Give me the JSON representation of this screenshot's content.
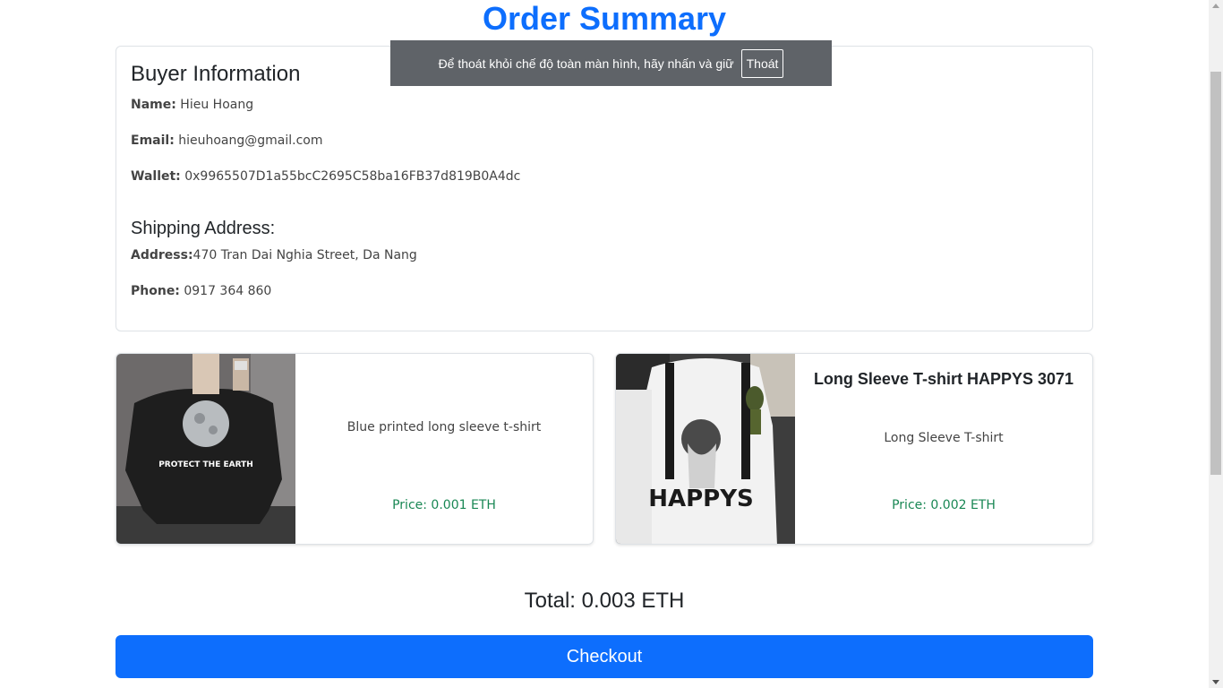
{
  "page": {
    "title": "Order Summary"
  },
  "buyer": {
    "heading": "Buyer Information",
    "name_label": "Name:",
    "name": " Hieu Hoang",
    "email_label": "Email:",
    "email": " hieuhoang@gmail.com",
    "wallet_label": "Wallet:",
    "wallet": " 0x9965507D1a55bcC2695C58ba16FB37d819B0A4dc"
  },
  "shipping": {
    "heading": "Shipping Address:",
    "address_label": "Address:",
    "address": "470 Tran Dai Nghia Street, Da Nang",
    "phone_label": "Phone:",
    "phone": " 0917 364 860"
  },
  "products": [
    {
      "title": "",
      "description": "Blue printed long sleeve t-shirt",
      "price": "Price: 0.001 ETH",
      "image_text": "PROTECT THE EARTH"
    },
    {
      "title": "Long Sleeve T-shirt HAPPYS 3071",
      "description": "Long Sleeve T-shirt",
      "price": "Price: 0.002 ETH",
      "image_text": "HAPPYS"
    }
  ],
  "total": "Total: 0.003 ETH",
  "checkout_label": "Checkout",
  "fullscreen_toast": {
    "message": "Để thoát khỏi chế độ toàn màn hình, hãy nhấn và giữ",
    "exit_label": "Thoát"
  },
  "colors": {
    "accent": "#0d6efd",
    "price": "#198754",
    "toast_bg": "#5f6368"
  }
}
